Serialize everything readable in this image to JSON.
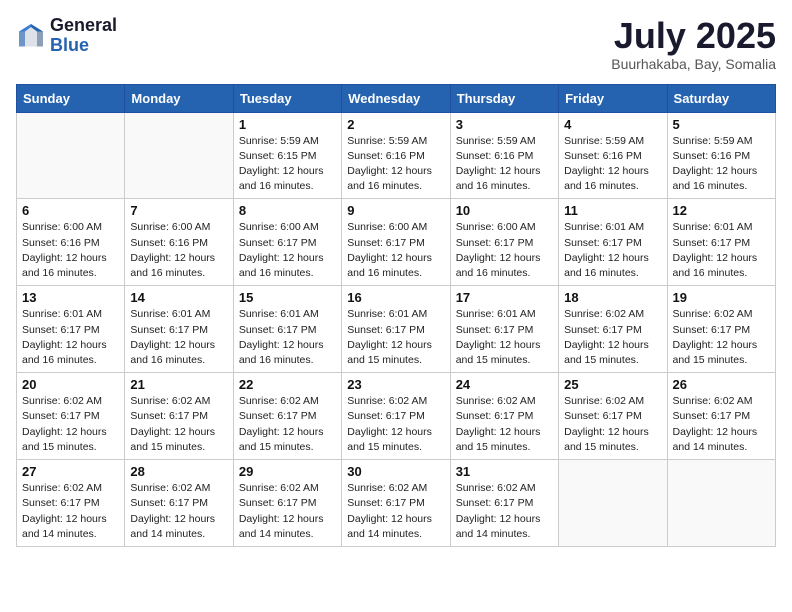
{
  "header": {
    "logo_general": "General",
    "logo_blue": "Blue",
    "month_title": "July 2025",
    "location": "Buurhakaba, Bay, Somalia"
  },
  "days_of_week": [
    "Sunday",
    "Monday",
    "Tuesday",
    "Wednesday",
    "Thursday",
    "Friday",
    "Saturday"
  ],
  "weeks": [
    [
      {
        "day": "",
        "info": ""
      },
      {
        "day": "",
        "info": ""
      },
      {
        "day": "1",
        "info": "Sunrise: 5:59 AM\nSunset: 6:15 PM\nDaylight: 12 hours and 16 minutes."
      },
      {
        "day": "2",
        "info": "Sunrise: 5:59 AM\nSunset: 6:16 PM\nDaylight: 12 hours and 16 minutes."
      },
      {
        "day": "3",
        "info": "Sunrise: 5:59 AM\nSunset: 6:16 PM\nDaylight: 12 hours and 16 minutes."
      },
      {
        "day": "4",
        "info": "Sunrise: 5:59 AM\nSunset: 6:16 PM\nDaylight: 12 hours and 16 minutes."
      },
      {
        "day": "5",
        "info": "Sunrise: 5:59 AM\nSunset: 6:16 PM\nDaylight: 12 hours and 16 minutes."
      }
    ],
    [
      {
        "day": "6",
        "info": "Sunrise: 6:00 AM\nSunset: 6:16 PM\nDaylight: 12 hours and 16 minutes."
      },
      {
        "day": "7",
        "info": "Sunrise: 6:00 AM\nSunset: 6:16 PM\nDaylight: 12 hours and 16 minutes."
      },
      {
        "day": "8",
        "info": "Sunrise: 6:00 AM\nSunset: 6:17 PM\nDaylight: 12 hours and 16 minutes."
      },
      {
        "day": "9",
        "info": "Sunrise: 6:00 AM\nSunset: 6:17 PM\nDaylight: 12 hours and 16 minutes."
      },
      {
        "day": "10",
        "info": "Sunrise: 6:00 AM\nSunset: 6:17 PM\nDaylight: 12 hours and 16 minutes."
      },
      {
        "day": "11",
        "info": "Sunrise: 6:01 AM\nSunset: 6:17 PM\nDaylight: 12 hours and 16 minutes."
      },
      {
        "day": "12",
        "info": "Sunrise: 6:01 AM\nSunset: 6:17 PM\nDaylight: 12 hours and 16 minutes."
      }
    ],
    [
      {
        "day": "13",
        "info": "Sunrise: 6:01 AM\nSunset: 6:17 PM\nDaylight: 12 hours and 16 minutes."
      },
      {
        "day": "14",
        "info": "Sunrise: 6:01 AM\nSunset: 6:17 PM\nDaylight: 12 hours and 16 minutes."
      },
      {
        "day": "15",
        "info": "Sunrise: 6:01 AM\nSunset: 6:17 PM\nDaylight: 12 hours and 16 minutes."
      },
      {
        "day": "16",
        "info": "Sunrise: 6:01 AM\nSunset: 6:17 PM\nDaylight: 12 hours and 15 minutes."
      },
      {
        "day": "17",
        "info": "Sunrise: 6:01 AM\nSunset: 6:17 PM\nDaylight: 12 hours and 15 minutes."
      },
      {
        "day": "18",
        "info": "Sunrise: 6:02 AM\nSunset: 6:17 PM\nDaylight: 12 hours and 15 minutes."
      },
      {
        "day": "19",
        "info": "Sunrise: 6:02 AM\nSunset: 6:17 PM\nDaylight: 12 hours and 15 minutes."
      }
    ],
    [
      {
        "day": "20",
        "info": "Sunrise: 6:02 AM\nSunset: 6:17 PM\nDaylight: 12 hours and 15 minutes."
      },
      {
        "day": "21",
        "info": "Sunrise: 6:02 AM\nSunset: 6:17 PM\nDaylight: 12 hours and 15 minutes."
      },
      {
        "day": "22",
        "info": "Sunrise: 6:02 AM\nSunset: 6:17 PM\nDaylight: 12 hours and 15 minutes."
      },
      {
        "day": "23",
        "info": "Sunrise: 6:02 AM\nSunset: 6:17 PM\nDaylight: 12 hours and 15 minutes."
      },
      {
        "day": "24",
        "info": "Sunrise: 6:02 AM\nSunset: 6:17 PM\nDaylight: 12 hours and 15 minutes."
      },
      {
        "day": "25",
        "info": "Sunrise: 6:02 AM\nSunset: 6:17 PM\nDaylight: 12 hours and 15 minutes."
      },
      {
        "day": "26",
        "info": "Sunrise: 6:02 AM\nSunset: 6:17 PM\nDaylight: 12 hours and 14 minutes."
      }
    ],
    [
      {
        "day": "27",
        "info": "Sunrise: 6:02 AM\nSunset: 6:17 PM\nDaylight: 12 hours and 14 minutes."
      },
      {
        "day": "28",
        "info": "Sunrise: 6:02 AM\nSunset: 6:17 PM\nDaylight: 12 hours and 14 minutes."
      },
      {
        "day": "29",
        "info": "Sunrise: 6:02 AM\nSunset: 6:17 PM\nDaylight: 12 hours and 14 minutes."
      },
      {
        "day": "30",
        "info": "Sunrise: 6:02 AM\nSunset: 6:17 PM\nDaylight: 12 hours and 14 minutes."
      },
      {
        "day": "31",
        "info": "Sunrise: 6:02 AM\nSunset: 6:17 PM\nDaylight: 12 hours and 14 minutes."
      },
      {
        "day": "",
        "info": ""
      },
      {
        "day": "",
        "info": ""
      }
    ]
  ]
}
